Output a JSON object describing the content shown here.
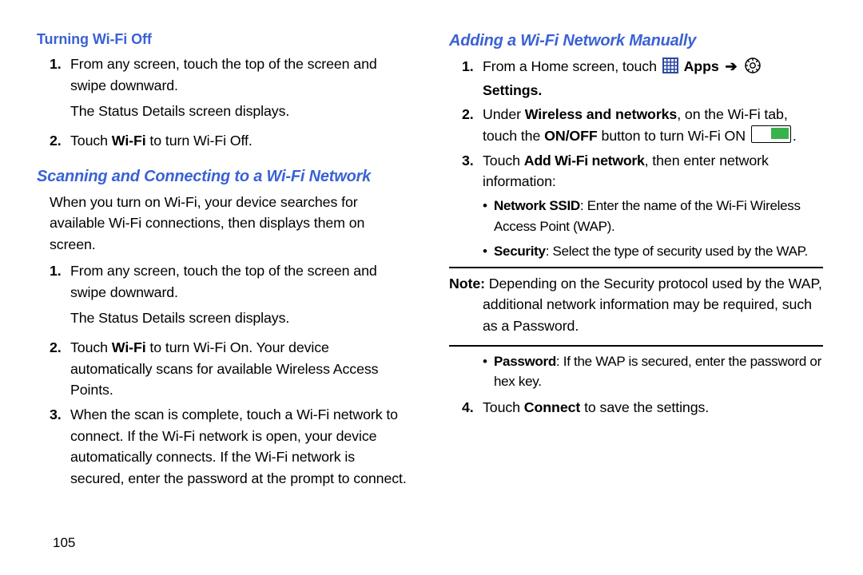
{
  "pageNumber": "105",
  "left": {
    "h1": "Turning Wi-Fi Off",
    "l1_pre": "From any screen, touch the top of the screen and swipe downward.",
    "l1_after": "The Status Details screen displays.",
    "l2_pre": "Touch ",
    "l2_b": "Wi-Fi",
    "l2_post": " to turn Wi-Fi Off.",
    "h2": "Scanning and Connecting to a Wi-Fi Network",
    "intro": "When you turn on Wi-Fi, your device searches for available Wi-Fi connections, then displays them on screen.",
    "s1": "From any screen, touch the top of the screen and swipe downward.",
    "s1_after": "The Status Details screen displays.",
    "s2_pre": "Touch ",
    "s2_b": "Wi-Fi",
    "s2_post": " to turn Wi-Fi On. Your device automatically scans for available Wireless Access Points.",
    "s3": "When the scan is complete, touch a Wi-Fi network to connect. If the Wi-Fi network is open, your device automatically connects. If the Wi-Fi network is secured, enter the password at the prompt to connect."
  },
  "right": {
    "h1": "Adding a Wi-Fi Network Manually",
    "r1_pre": "From a Home screen, touch ",
    "apps": "Apps",
    "settings": "Settings",
    "r2_pre": "Under ",
    "r2_b": "Wireless and networks",
    "r2_mid": ", on the Wi-Fi tab, touch the ",
    "r2_b2": "ON/OFF",
    "r2_post": " button to turn Wi-Fi ON ",
    "r3_pre": "Touch ",
    "r3_b": "Add Wi-Fi network",
    "r3_post": ", then enter network information:",
    "b1_b": "Network SSID",
    "b1": ": Enter the name of the Wi-Fi Wireless Access Point (WAP).",
    "b2_b": "Security",
    "b2": ": Select the type of security used by the WAP.",
    "note_label": "Note:",
    "note": " Depending on the Security protocol used by the WAP, additional network information may be required, such as a Password.",
    "b3_b": "Password",
    "b3": ": If the WAP is secured, enter the password or hex key.",
    "r4_pre": "Touch ",
    "r4_b": "Connect",
    "r4_post": " to save the settings."
  }
}
